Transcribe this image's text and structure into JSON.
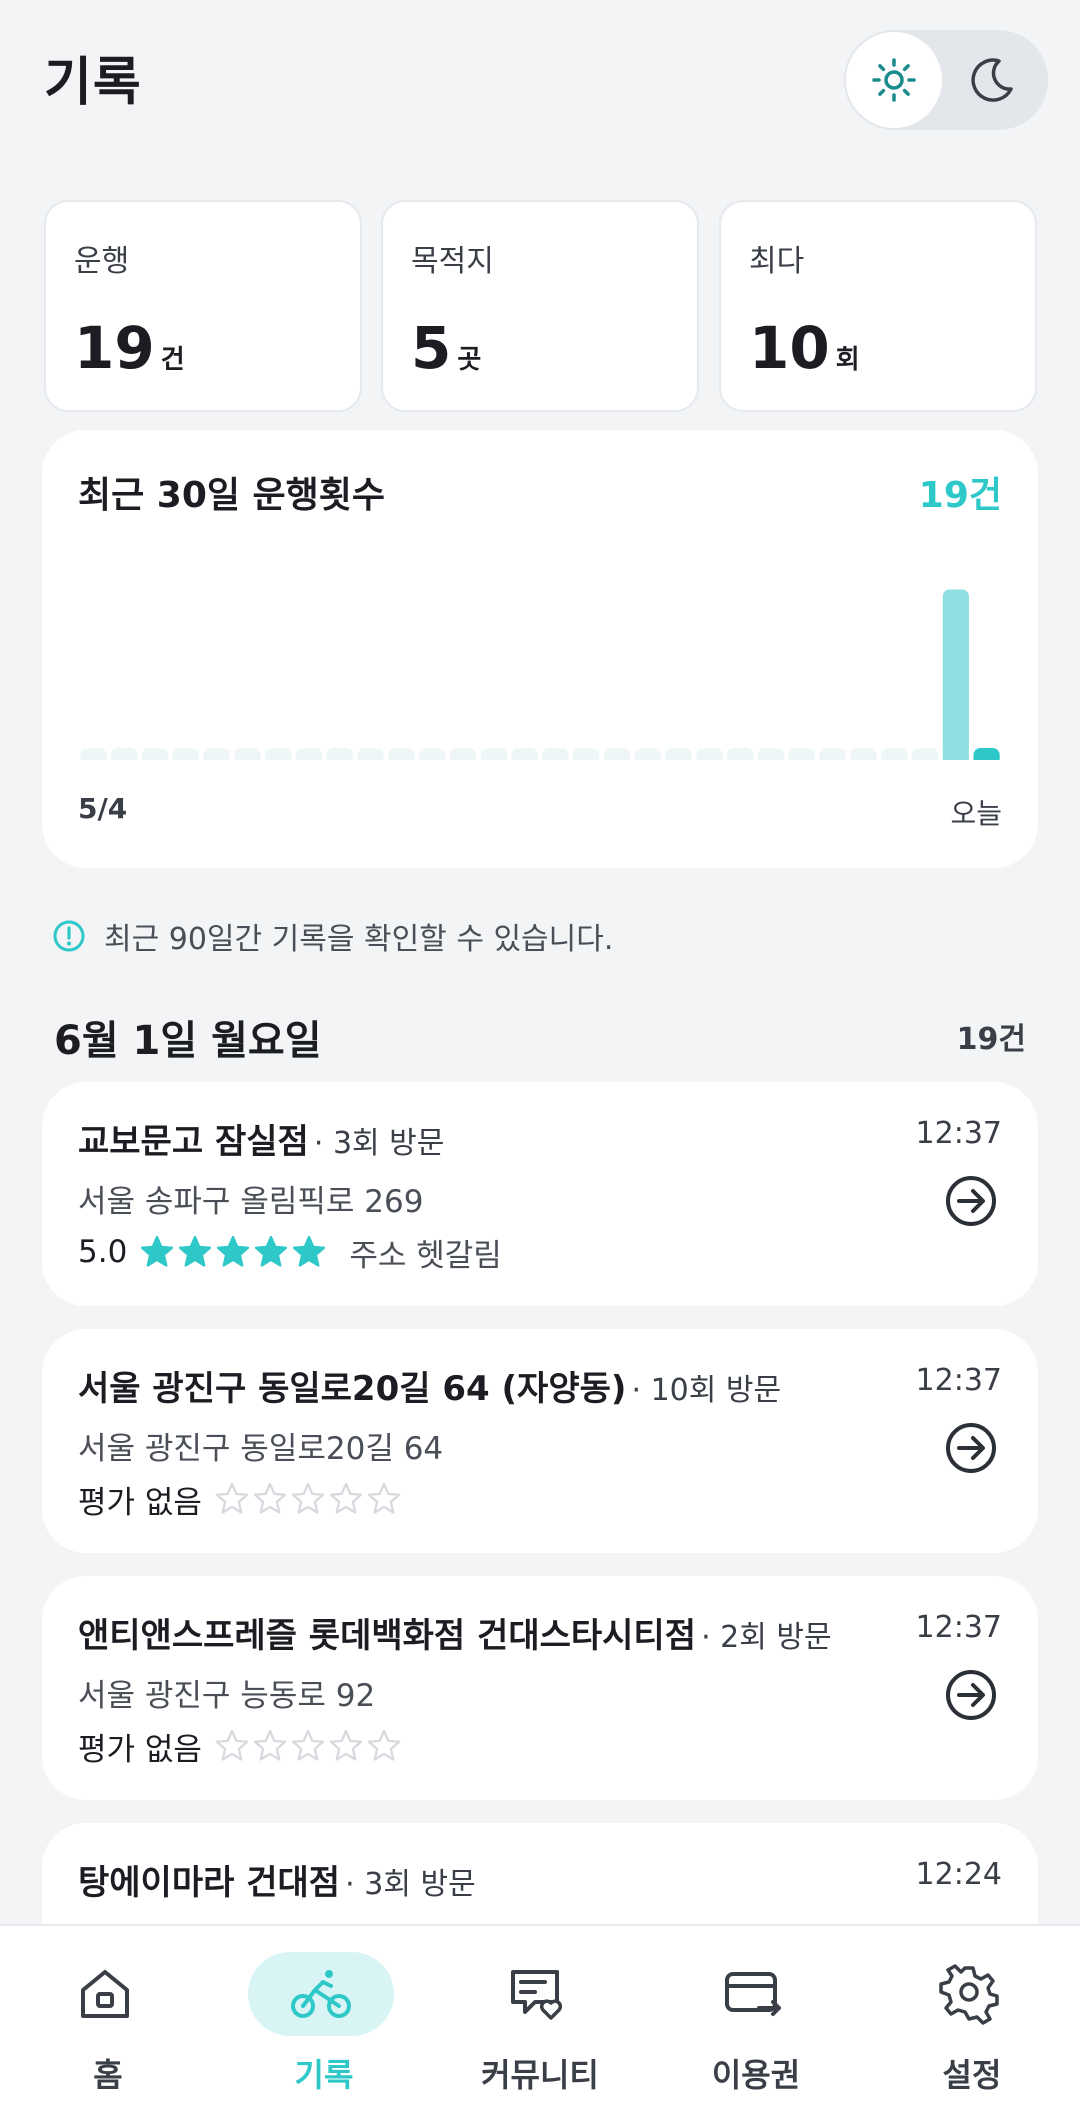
{
  "header": {
    "title": "기록",
    "theme_light_icon": "sun-icon",
    "theme_dark_icon": "moon-icon"
  },
  "stats": [
    {
      "label": "운행",
      "value": "19",
      "unit": "건"
    },
    {
      "label": "목적지",
      "value": "5",
      "unit": "곳"
    },
    {
      "label": "최다",
      "value": "10",
      "unit": "회"
    }
  ],
  "chart": {
    "title": "최근 30일 운행횟수",
    "total": "19건",
    "start_label": "5/4",
    "end_label": "오늘",
    "accent_color": "#2ec8c8"
  },
  "chart_data": {
    "type": "bar",
    "title": "최근 30일 운행횟수",
    "categories": [
      "5/4",
      "",
      "",
      "",
      "",
      "",
      "",
      "",
      "",
      "",
      "",
      "",
      "",
      "",
      "",
      "",
      "",
      "",
      "",
      "",
      "",
      "",
      "",
      "",
      "",
      "",
      "",
      "",
      "",
      "오늘"
    ],
    "values": [
      0,
      0,
      0,
      0,
      0,
      0,
      0,
      0,
      0,
      0,
      0,
      0,
      0,
      0,
      0,
      0,
      0,
      0,
      0,
      0,
      0,
      0,
      0,
      0,
      0,
      0,
      0,
      0,
      18,
      1
    ],
    "ylim": [
      0,
      19
    ]
  },
  "notice": {
    "icon": "info-icon",
    "text": "최근 90일간 기록을 확인할 수 있습니다."
  },
  "day_group": {
    "date": "6월 1일 월요일",
    "count": "19건"
  },
  "trips": [
    {
      "name": "교보문고 잠실점",
      "visits": "· 3회 방문",
      "time": "12:37",
      "address": "서울 송파구 올림픽로 269",
      "score": "5.0",
      "rating": 5,
      "review": "주소 헷갈림"
    },
    {
      "name": "서울 광진구 동일로20길 64 (자양동)",
      "visits": "· 10회 방문",
      "time": "12:37",
      "address": "서울 광진구 동일로20길 64",
      "score": "평가 없음",
      "rating": 0,
      "review": ""
    },
    {
      "name": "앤티앤스프레즐 롯데백화점 건대스타시티점",
      "visits": "· 2회 방문",
      "time": "12:37",
      "address": "서울 광진구 능동로 92",
      "score": "평가 없음",
      "rating": 0,
      "review": ""
    },
    {
      "name": "탕에이마라 건대점",
      "visits": "· 3회 방문",
      "time": "12:24",
      "address": "",
      "score": "",
      "rating": 0,
      "review": ""
    }
  ],
  "nav": [
    {
      "label": "홈",
      "icon": "home-icon",
      "active": false
    },
    {
      "label": "기록",
      "icon": "bike-icon",
      "active": true
    },
    {
      "label": "커뮤니티",
      "icon": "community-icon",
      "active": false
    },
    {
      "label": "이용권",
      "icon": "ticket-card-icon",
      "active": false
    },
    {
      "label": "설정",
      "icon": "settings-gear-icon",
      "active": false
    }
  ]
}
